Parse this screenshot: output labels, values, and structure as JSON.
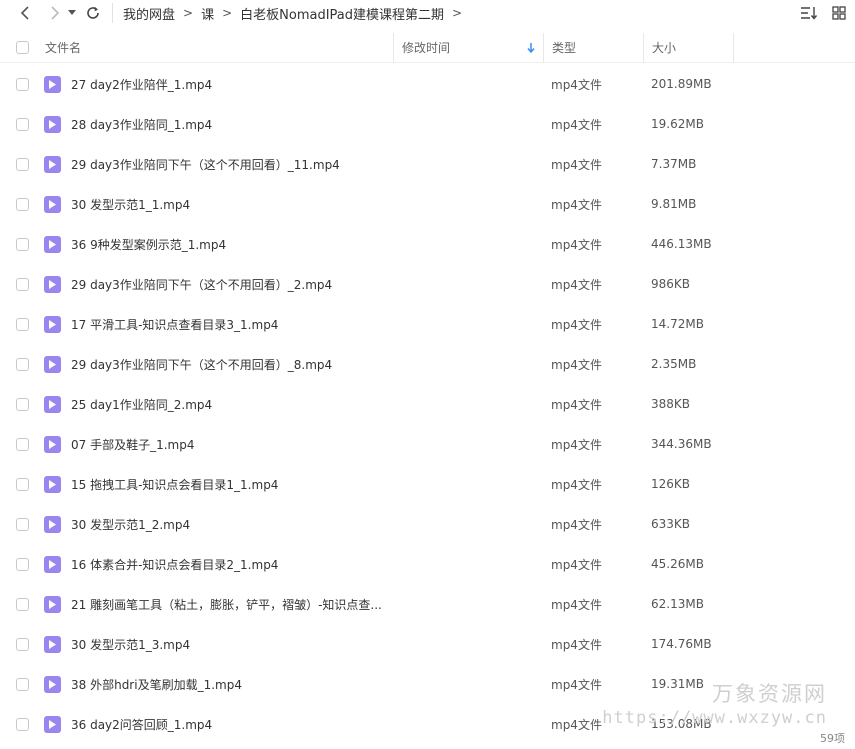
{
  "breadcrumb": [
    {
      "label": "我的网盘"
    },
    {
      "label": "课"
    },
    {
      "label": "白老板NomadIPad建模课程第二期"
    }
  ],
  "columns": {
    "name": "文件名",
    "modified": "修改时间",
    "type": "类型",
    "size": "大小"
  },
  "files": [
    {
      "name": "27  day2作业陪伴_1.mp4",
      "type": "mp4文件",
      "size": "201.89MB"
    },
    {
      "name": "28  day3作业陪同_1.mp4",
      "type": "mp4文件",
      "size": "19.62MB"
    },
    {
      "name": "29  day3作业陪同下午（这个不用回看）_11.mp4",
      "type": "mp4文件",
      "size": "7.37MB"
    },
    {
      "name": "30  发型示范1_1.mp4",
      "type": "mp4文件",
      "size": "9.81MB"
    },
    {
      "name": "36  9种发型案例示范_1.mp4",
      "type": "mp4文件",
      "size": "446.13MB"
    },
    {
      "name": "29  day3作业陪同下午（这个不用回看）_2.mp4",
      "type": "mp4文件",
      "size": "986KB"
    },
    {
      "name": "17  平滑工具-知识点查看目录3_1.mp4",
      "type": "mp4文件",
      "size": "14.72MB"
    },
    {
      "name": "29  day3作业陪同下午（这个不用回看）_8.mp4",
      "type": "mp4文件",
      "size": "2.35MB"
    },
    {
      "name": "25  day1作业陪同_2.mp4",
      "type": "mp4文件",
      "size": "388KB"
    },
    {
      "name": "07  手部及鞋子_1.mp4",
      "type": "mp4文件",
      "size": "344.36MB"
    },
    {
      "name": "15  拖拽工具-知识点会看目录1_1.mp4",
      "type": "mp4文件",
      "size": "126KB"
    },
    {
      "name": "30  发型示范1_2.mp4",
      "type": "mp4文件",
      "size": "633KB"
    },
    {
      "name": "16  体素合并-知识点会看目录2_1.mp4",
      "type": "mp4文件",
      "size": "45.26MB"
    },
    {
      "name": "21  雕刻画笔工具（粘土，膨胀，铲平，褶皱）-知识点查...",
      "type": "mp4文件",
      "size": "62.13MB"
    },
    {
      "name": "30  发型示范1_3.mp4",
      "type": "mp4文件",
      "size": "174.76MB"
    },
    {
      "name": "38  外部hdri及笔刷加载_1.mp4",
      "type": "mp4文件",
      "size": "19.31MB"
    },
    {
      "name": "36  day2问答回顾_1.mp4",
      "type": "mp4文件",
      "size": "153.08MB"
    }
  ],
  "watermark": {
    "cn": "万象资源网",
    "url": "https://www.wxzyw.cn"
  },
  "footer": {
    "count": "59项"
  },
  "colors": {
    "file_icon": "#9b86f0",
    "sort_arrow": "#3b8cf5"
  }
}
